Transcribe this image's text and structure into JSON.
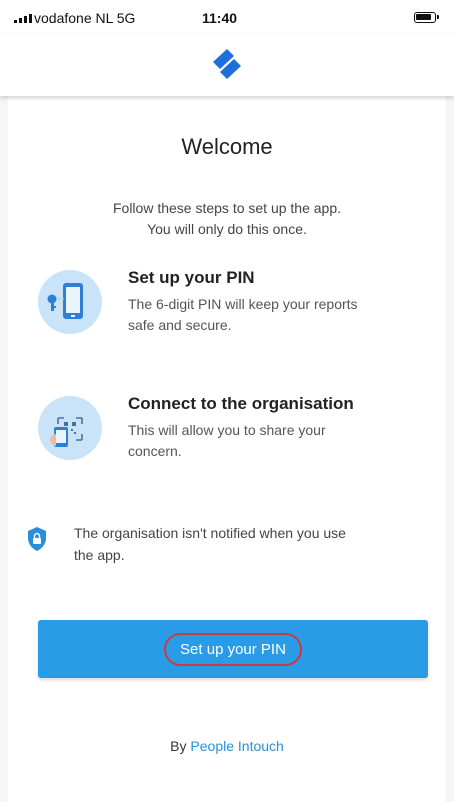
{
  "status_bar": {
    "carrier": "vodafone NL  5G",
    "time": "11:40",
    "signal_icon": "signal-bars-icon",
    "battery_icon": "battery-icon"
  },
  "header": {
    "logo_icon": "people-intouch-logo",
    "brand_color": "#1e6fd9"
  },
  "welcome": {
    "title": "Welcome",
    "intro_line1": "Follow these steps to set up the app.",
    "intro_line2": "You will only do this once."
  },
  "steps": [
    {
      "icon": "phone-key-icon",
      "title": "Set up your PIN",
      "desc_line1": "The 6-digit PIN will keep your reports",
      "desc_line2": "safe and secure."
    },
    {
      "icon": "qr-scan-phone-icon",
      "title": "Connect to the organisation",
      "desc_line1": "This will allow you to share your",
      "desc_line2": "concern."
    }
  ],
  "notice": {
    "icon": "shield-icon",
    "line1": "The organisation isn't notified when you use",
    "line2": "the app."
  },
  "cta": {
    "label": "Set up your PIN",
    "color": "#2a9be6"
  },
  "footer": {
    "prefix": "By",
    "link": "People Intouch",
    "link_color": "#2a8fd8"
  }
}
